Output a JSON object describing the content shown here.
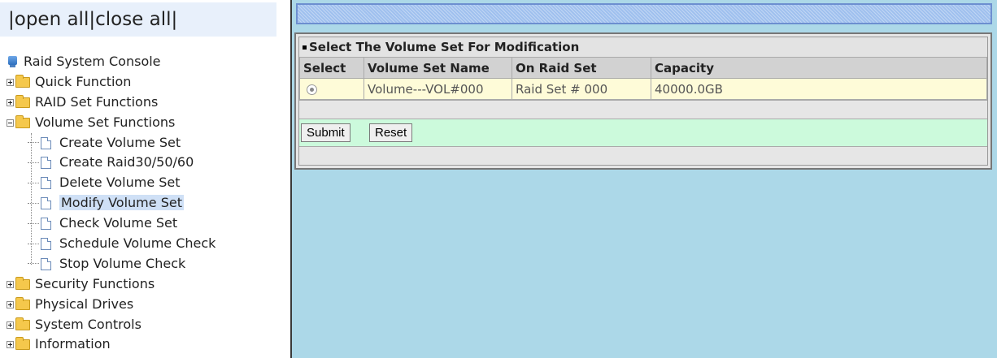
{
  "nav": {
    "bar_left": "|",
    "open_all": "open all",
    "separator": "|",
    "close_all": "close all",
    "bar_right": "|"
  },
  "tree": {
    "root_label": "Raid System Console",
    "items": [
      {
        "label": "Quick Function",
        "expanded": false
      },
      {
        "label": "RAID Set Functions",
        "expanded": false
      },
      {
        "label": "Volume Set Functions",
        "expanded": true
      },
      {
        "label": "Security Functions",
        "expanded": false
      },
      {
        "label": "Physical Drives",
        "expanded": false
      },
      {
        "label": "System Controls",
        "expanded": false
      },
      {
        "label": "Information",
        "expanded": false
      }
    ],
    "volume_children": [
      "Create Volume Set",
      "Create Raid30/50/60",
      "Delete Volume Set",
      "Modify Volume Set",
      "Check Volume Set",
      "Schedule Volume Check",
      "Stop Volume Check"
    ],
    "selected_child": "Modify Volume Set"
  },
  "form": {
    "title": "Select The Volume Set For Modification",
    "columns": [
      "Select",
      "Volume Set Name",
      "On Raid Set",
      "Capacity"
    ],
    "rows": [
      {
        "selected": true,
        "name": "Volume---VOL#000",
        "raid_set": "Raid Set # 000",
        "capacity": "40000.0GB"
      }
    ],
    "submit_label": "Submit",
    "reset_label": "Reset"
  },
  "colors": {
    "content_bg": "#acd8e8",
    "row_bg": "#fefbd8",
    "button_row_bg": "#ccfadc",
    "header_bg": "#d2d2d2"
  }
}
